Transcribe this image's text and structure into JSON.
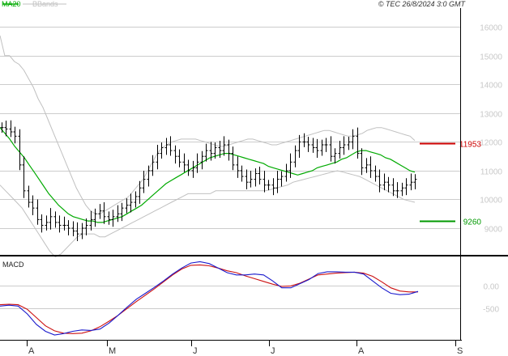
{
  "header": {
    "legend_ma": "MA20",
    "legend_bb": "BBands",
    "copyright": "© TEC 26/8/2024 3:0 GMT"
  },
  "colors": {
    "price": "#000000",
    "ma": "#00aa00",
    "bands": "#c0c0c0",
    "grid": "#cccccc",
    "axis_text": "#c8c8c8",
    "resistance": "#cc0000",
    "support": "#009900",
    "macd": "#1a1acc",
    "signal": "#cc1111"
  },
  "chart_data": [
    {
      "type": "candlestick",
      "panel": "price",
      "ylim": [
        8100,
        16600
      ],
      "y_ticks": [
        9000,
        10000,
        11000,
        12000,
        13000,
        14000,
        15000,
        16000
      ],
      "y_tick_labels": [
        "9000",
        "10000",
        "11000",
        "12000",
        "13000",
        "14000",
        "15000",
        "16000"
      ],
      "x_ticks": [
        "A",
        "M",
        "J",
        "J",
        "A",
        "S"
      ],
      "levels": [
        {
          "label": "11953",
          "value": 11953,
          "color": "#cc0000"
        },
        {
          "label": "9260",
          "value": 9260,
          "color": "#009900"
        }
      ],
      "close": [
        12500,
        12450,
        12350,
        12200,
        11200,
        10300,
        9900,
        9700,
        9300,
        9100,
        9200,
        9400,
        9200,
        9100,
        9100,
        9000,
        8900,
        8800,
        9000,
        9100,
        9300,
        9500,
        9600,
        9400,
        9300,
        9400,
        9500,
        9700,
        9800,
        9900,
        10100,
        10400,
        10700,
        11000,
        11300,
        11600,
        11800,
        11900,
        11700,
        11500,
        11300,
        11200,
        11000,
        11100,
        11300,
        11500,
        11700,
        11600,
        11800,
        11700,
        11900,
        11600,
        11200,
        11000,
        10800,
        10600,
        10700,
        10900,
        10700,
        10500,
        10500,
        10400,
        10700,
        10800,
        11000,
        11300,
        11700,
        12000,
        12000,
        11900,
        11800,
        11700,
        11900,
        11900,
        11500,
        11600,
        11800,
        11900,
        12000,
        12200,
        11600,
        11100,
        11200,
        11000,
        10800,
        10500,
        10600,
        10500,
        10300,
        10300,
        10400,
        10500,
        10600,
        10700
      ],
      "ma": [
        12500,
        12300,
        12100,
        11850,
        11650,
        11450,
        11200,
        10950,
        10700,
        10450,
        10200,
        10000,
        9800,
        9650,
        9500,
        9400,
        9350,
        9300,
        9250,
        9250,
        9200,
        9200,
        9250,
        9300,
        9350,
        9400,
        9500,
        9600,
        9700,
        9800,
        9950,
        10100,
        10250,
        10400,
        10550,
        10650,
        10750,
        10850,
        10950,
        11050,
        11150,
        11250,
        11350,
        11450,
        11500,
        11550,
        11600,
        11600,
        11550,
        11500,
        11450,
        11400,
        11350,
        11300,
        11250,
        11150,
        11100,
        11050,
        11000,
        10950,
        10900,
        10850,
        10900,
        10950,
        11000,
        11100,
        11150,
        11200,
        11250,
        11300,
        11400,
        11450,
        11550,
        11650,
        11700,
        11700,
        11650,
        11600,
        11550,
        11450,
        11400,
        11300,
        11200,
        11100,
        11000,
        10950
      ],
      "bb_upper": [
        15700,
        15000,
        15000,
        14800,
        14700,
        14500,
        14200,
        13900,
        13500,
        13200,
        12800,
        12400,
        12000,
        11600,
        11200,
        10800,
        10400,
        10100,
        9800,
        9600,
        9500,
        9500,
        9600,
        9700,
        9800,
        9900,
        10000,
        10100,
        10300,
        10500,
        10700,
        11000,
        11300,
        11600,
        11800,
        11900,
        12000,
        12050,
        12100,
        12100,
        12100,
        12100,
        12050,
        12000,
        11950,
        11900,
        11850,
        11850,
        11900,
        11950,
        12000,
        12050,
        12100,
        12100,
        12050,
        12000,
        11950,
        11900,
        11900,
        11950,
        12000,
        12050,
        12100,
        12150,
        12200,
        12250,
        12300,
        12350,
        12400,
        12400,
        12350,
        12300,
        12250,
        12200,
        12200,
        12250,
        12300,
        12400,
        12450,
        12500,
        12500,
        12450,
        12400,
        12350,
        12300,
        12250,
        12200,
        12050
      ],
      "bb_lower": [
        10500,
        10300,
        10100,
        9900,
        9700,
        9400,
        9100,
        8800,
        8500,
        8200,
        8000,
        8100,
        8300,
        8500,
        8700,
        8800,
        8800,
        8800,
        8700,
        8700,
        8800,
        8900,
        9000,
        9100,
        9200,
        9300,
        9400,
        9500,
        9600,
        9700,
        9800,
        9900,
        10000,
        10100,
        10200,
        10200,
        10200,
        10200,
        10200,
        10300,
        10300,
        10300,
        10300,
        10300,
        10300,
        10300,
        10300,
        10300,
        10300,
        10350,
        10400,
        10450,
        10500,
        10600,
        10650,
        10700,
        10750,
        10800,
        10850,
        10900,
        10950,
        11000,
        10950,
        10900,
        10850,
        10800,
        10700,
        10600,
        10500,
        10400,
        10300,
        10200,
        10100,
        10000,
        9950,
        9900
      ]
    },
    {
      "type": "line",
      "panel": "indicator",
      "title": "MACD",
      "ylim": [
        -1150,
        580
      ],
      "y_ticks": [
        0,
        -500
      ],
      "y_tick_labels": [
        "0.00",
        "-500"
      ],
      "series": [
        {
          "name": "MACD",
          "color": "#1a1acc",
          "values": [
            -450,
            -430,
            -450,
            -620,
            -850,
            -1000,
            -1080,
            -1050,
            -1000,
            -970,
            -980,
            -950,
            -820,
            -650,
            -470,
            -300,
            -170,
            -40,
            100,
            250,
            380,
            490,
            520,
            480,
            380,
            280,
            230,
            230,
            250,
            230,
            100,
            -50,
            -50,
            40,
            130,
            260,
            300,
            300,
            290,
            290,
            250,
            100,
            -50,
            -170,
            -200,
            -190,
            -130
          ]
        },
        {
          "name": "Signal",
          "color": "#cc1111",
          "values": [
            -420,
            -410,
            -420,
            -520,
            -700,
            -880,
            -990,
            -1040,
            -1050,
            -1040,
            -990,
            -900,
            -780,
            -650,
            -500,
            -350,
            -210,
            -70,
            80,
            230,
            360,
            440,
            450,
            430,
            380,
            320,
            280,
            210,
            150,
            90,
            30,
            -20,
            -10,
            50,
            140,
            230,
            250,
            270,
            280,
            290,
            270,
            200,
            80,
            -50,
            -120,
            -140,
            -140
          ]
        }
      ]
    }
  ]
}
